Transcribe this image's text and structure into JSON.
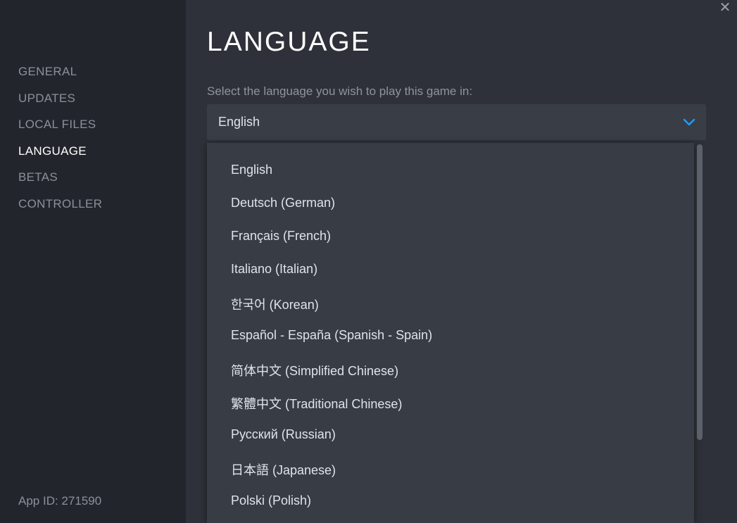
{
  "sidebar": {
    "items": [
      {
        "label": "GENERAL"
      },
      {
        "label": "UPDATES"
      },
      {
        "label": "LOCAL FILES"
      },
      {
        "label": "LANGUAGE"
      },
      {
        "label": "BETAS"
      },
      {
        "label": "CONTROLLER"
      }
    ],
    "active": "LANGUAGE",
    "app_id": "App ID: 271590"
  },
  "main": {
    "title": "LANGUAGE",
    "prompt": "Select the language you wish to play this game in:",
    "selected_language": "English",
    "options": [
      "English",
      "Deutsch (German)",
      "Français (French)",
      "Italiano (Italian)",
      "한국어 (Korean)",
      "Español - España (Spanish - Spain)",
      "简体中文 (Simplified Chinese)",
      "繁體中文 (Traditional Chinese)",
      "Русский (Russian)",
      "日本語 (Japanese)",
      "Polski (Polish)"
    ]
  },
  "icons": {
    "close": "close-icon",
    "dropdown": "chevron-down-icon"
  },
  "colors": {
    "accent": "#1a9fff",
    "sidebar_bg": "#22252c",
    "main_bg": "#2e3139",
    "dropdown_bg": "#383c45"
  }
}
